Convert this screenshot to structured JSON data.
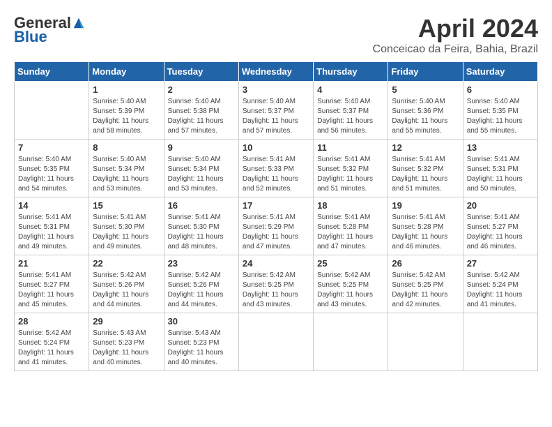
{
  "header": {
    "logo_general": "General",
    "logo_blue": "Blue",
    "month_title": "April 2024",
    "location": "Conceicao da Feira, Bahia, Brazil"
  },
  "days_of_week": [
    "Sunday",
    "Monday",
    "Tuesday",
    "Wednesday",
    "Thursday",
    "Friday",
    "Saturday"
  ],
  "weeks": [
    [
      {
        "day": "",
        "info": ""
      },
      {
        "day": "1",
        "info": "Sunrise: 5:40 AM\nSunset: 5:39 PM\nDaylight: 11 hours\nand 58 minutes."
      },
      {
        "day": "2",
        "info": "Sunrise: 5:40 AM\nSunset: 5:38 PM\nDaylight: 11 hours\nand 57 minutes."
      },
      {
        "day": "3",
        "info": "Sunrise: 5:40 AM\nSunset: 5:37 PM\nDaylight: 11 hours\nand 57 minutes."
      },
      {
        "day": "4",
        "info": "Sunrise: 5:40 AM\nSunset: 5:37 PM\nDaylight: 11 hours\nand 56 minutes."
      },
      {
        "day": "5",
        "info": "Sunrise: 5:40 AM\nSunset: 5:36 PM\nDaylight: 11 hours\nand 55 minutes."
      },
      {
        "day": "6",
        "info": "Sunrise: 5:40 AM\nSunset: 5:35 PM\nDaylight: 11 hours\nand 55 minutes."
      }
    ],
    [
      {
        "day": "7",
        "info": "Sunrise: 5:40 AM\nSunset: 5:35 PM\nDaylight: 11 hours\nand 54 minutes."
      },
      {
        "day": "8",
        "info": "Sunrise: 5:40 AM\nSunset: 5:34 PM\nDaylight: 11 hours\nand 53 minutes."
      },
      {
        "day": "9",
        "info": "Sunrise: 5:40 AM\nSunset: 5:34 PM\nDaylight: 11 hours\nand 53 minutes."
      },
      {
        "day": "10",
        "info": "Sunrise: 5:41 AM\nSunset: 5:33 PM\nDaylight: 11 hours\nand 52 minutes."
      },
      {
        "day": "11",
        "info": "Sunrise: 5:41 AM\nSunset: 5:32 PM\nDaylight: 11 hours\nand 51 minutes."
      },
      {
        "day": "12",
        "info": "Sunrise: 5:41 AM\nSunset: 5:32 PM\nDaylight: 11 hours\nand 51 minutes."
      },
      {
        "day": "13",
        "info": "Sunrise: 5:41 AM\nSunset: 5:31 PM\nDaylight: 11 hours\nand 50 minutes."
      }
    ],
    [
      {
        "day": "14",
        "info": "Sunrise: 5:41 AM\nSunset: 5:31 PM\nDaylight: 11 hours\nand 49 minutes."
      },
      {
        "day": "15",
        "info": "Sunrise: 5:41 AM\nSunset: 5:30 PM\nDaylight: 11 hours\nand 49 minutes."
      },
      {
        "day": "16",
        "info": "Sunrise: 5:41 AM\nSunset: 5:30 PM\nDaylight: 11 hours\nand 48 minutes."
      },
      {
        "day": "17",
        "info": "Sunrise: 5:41 AM\nSunset: 5:29 PM\nDaylight: 11 hours\nand 47 minutes."
      },
      {
        "day": "18",
        "info": "Sunrise: 5:41 AM\nSunset: 5:28 PM\nDaylight: 11 hours\nand 47 minutes."
      },
      {
        "day": "19",
        "info": "Sunrise: 5:41 AM\nSunset: 5:28 PM\nDaylight: 11 hours\nand 46 minutes."
      },
      {
        "day": "20",
        "info": "Sunrise: 5:41 AM\nSunset: 5:27 PM\nDaylight: 11 hours\nand 46 minutes."
      }
    ],
    [
      {
        "day": "21",
        "info": "Sunrise: 5:41 AM\nSunset: 5:27 PM\nDaylight: 11 hours\nand 45 minutes."
      },
      {
        "day": "22",
        "info": "Sunrise: 5:42 AM\nSunset: 5:26 PM\nDaylight: 11 hours\nand 44 minutes."
      },
      {
        "day": "23",
        "info": "Sunrise: 5:42 AM\nSunset: 5:26 PM\nDaylight: 11 hours\nand 44 minutes."
      },
      {
        "day": "24",
        "info": "Sunrise: 5:42 AM\nSunset: 5:25 PM\nDaylight: 11 hours\nand 43 minutes."
      },
      {
        "day": "25",
        "info": "Sunrise: 5:42 AM\nSunset: 5:25 PM\nDaylight: 11 hours\nand 43 minutes."
      },
      {
        "day": "26",
        "info": "Sunrise: 5:42 AM\nSunset: 5:25 PM\nDaylight: 11 hours\nand 42 minutes."
      },
      {
        "day": "27",
        "info": "Sunrise: 5:42 AM\nSunset: 5:24 PM\nDaylight: 11 hours\nand 41 minutes."
      }
    ],
    [
      {
        "day": "28",
        "info": "Sunrise: 5:42 AM\nSunset: 5:24 PM\nDaylight: 11 hours\nand 41 minutes."
      },
      {
        "day": "29",
        "info": "Sunrise: 5:43 AM\nSunset: 5:23 PM\nDaylight: 11 hours\nand 40 minutes."
      },
      {
        "day": "30",
        "info": "Sunrise: 5:43 AM\nSunset: 5:23 PM\nDaylight: 11 hours\nand 40 minutes."
      },
      {
        "day": "",
        "info": ""
      },
      {
        "day": "",
        "info": ""
      },
      {
        "day": "",
        "info": ""
      },
      {
        "day": "",
        "info": ""
      }
    ]
  ]
}
